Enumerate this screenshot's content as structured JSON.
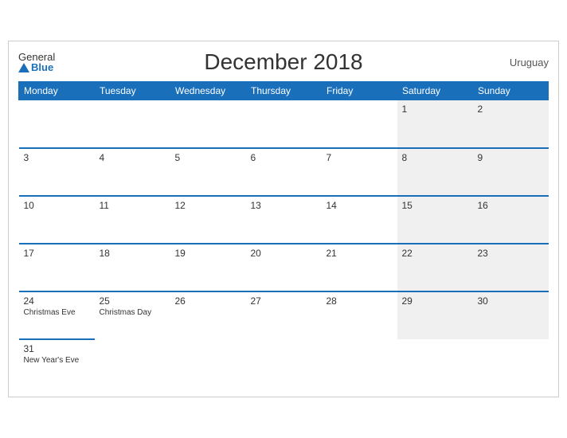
{
  "header": {
    "logo_general": "General",
    "logo_blue": "Blue",
    "title": "December 2018",
    "country": "Uruguay"
  },
  "columns": [
    "Monday",
    "Tuesday",
    "Wednesday",
    "Thursday",
    "Friday",
    "Saturday",
    "Sunday"
  ],
  "weeks": [
    [
      {
        "day": "",
        "event": "",
        "weekend": false
      },
      {
        "day": "",
        "event": "",
        "weekend": false
      },
      {
        "day": "",
        "event": "",
        "weekend": false
      },
      {
        "day": "",
        "event": "",
        "weekend": false
      },
      {
        "day": "",
        "event": "",
        "weekend": false
      },
      {
        "day": "1",
        "event": "",
        "weekend": true
      },
      {
        "day": "2",
        "event": "",
        "weekend": true
      }
    ],
    [
      {
        "day": "3",
        "event": "",
        "weekend": false
      },
      {
        "day": "4",
        "event": "",
        "weekend": false
      },
      {
        "day": "5",
        "event": "",
        "weekend": false
      },
      {
        "day": "6",
        "event": "",
        "weekend": false
      },
      {
        "day": "7",
        "event": "",
        "weekend": false
      },
      {
        "day": "8",
        "event": "",
        "weekend": true
      },
      {
        "day": "9",
        "event": "",
        "weekend": true
      }
    ],
    [
      {
        "day": "10",
        "event": "",
        "weekend": false
      },
      {
        "day": "11",
        "event": "",
        "weekend": false
      },
      {
        "day": "12",
        "event": "",
        "weekend": false
      },
      {
        "day": "13",
        "event": "",
        "weekend": false
      },
      {
        "day": "14",
        "event": "",
        "weekend": false
      },
      {
        "day": "15",
        "event": "",
        "weekend": true
      },
      {
        "day": "16",
        "event": "",
        "weekend": true
      }
    ],
    [
      {
        "day": "17",
        "event": "",
        "weekend": false
      },
      {
        "day": "18",
        "event": "",
        "weekend": false
      },
      {
        "day": "19",
        "event": "",
        "weekend": false
      },
      {
        "day": "20",
        "event": "",
        "weekend": false
      },
      {
        "day": "21",
        "event": "",
        "weekend": false
      },
      {
        "day": "22",
        "event": "",
        "weekend": true
      },
      {
        "day": "23",
        "event": "",
        "weekend": true
      }
    ],
    [
      {
        "day": "24",
        "event": "Christmas Eve",
        "weekend": false
      },
      {
        "day": "25",
        "event": "Christmas Day",
        "weekend": false
      },
      {
        "day": "26",
        "event": "",
        "weekend": false
      },
      {
        "day": "27",
        "event": "",
        "weekend": false
      },
      {
        "day": "28",
        "event": "",
        "weekend": false
      },
      {
        "day": "29",
        "event": "",
        "weekend": true
      },
      {
        "day": "30",
        "event": "",
        "weekend": true
      }
    ],
    [
      {
        "day": "31",
        "event": "New Year's Eve",
        "weekend": false
      },
      {
        "day": "",
        "event": "",
        "weekend": false,
        "empty": true
      },
      {
        "day": "",
        "event": "",
        "weekend": false,
        "empty": true
      },
      {
        "day": "",
        "event": "",
        "weekend": false,
        "empty": true
      },
      {
        "day": "",
        "event": "",
        "weekend": false,
        "empty": true
      },
      {
        "day": "",
        "event": "",
        "weekend": true,
        "empty": true
      },
      {
        "day": "",
        "event": "",
        "weekend": true,
        "empty": true
      }
    ]
  ]
}
